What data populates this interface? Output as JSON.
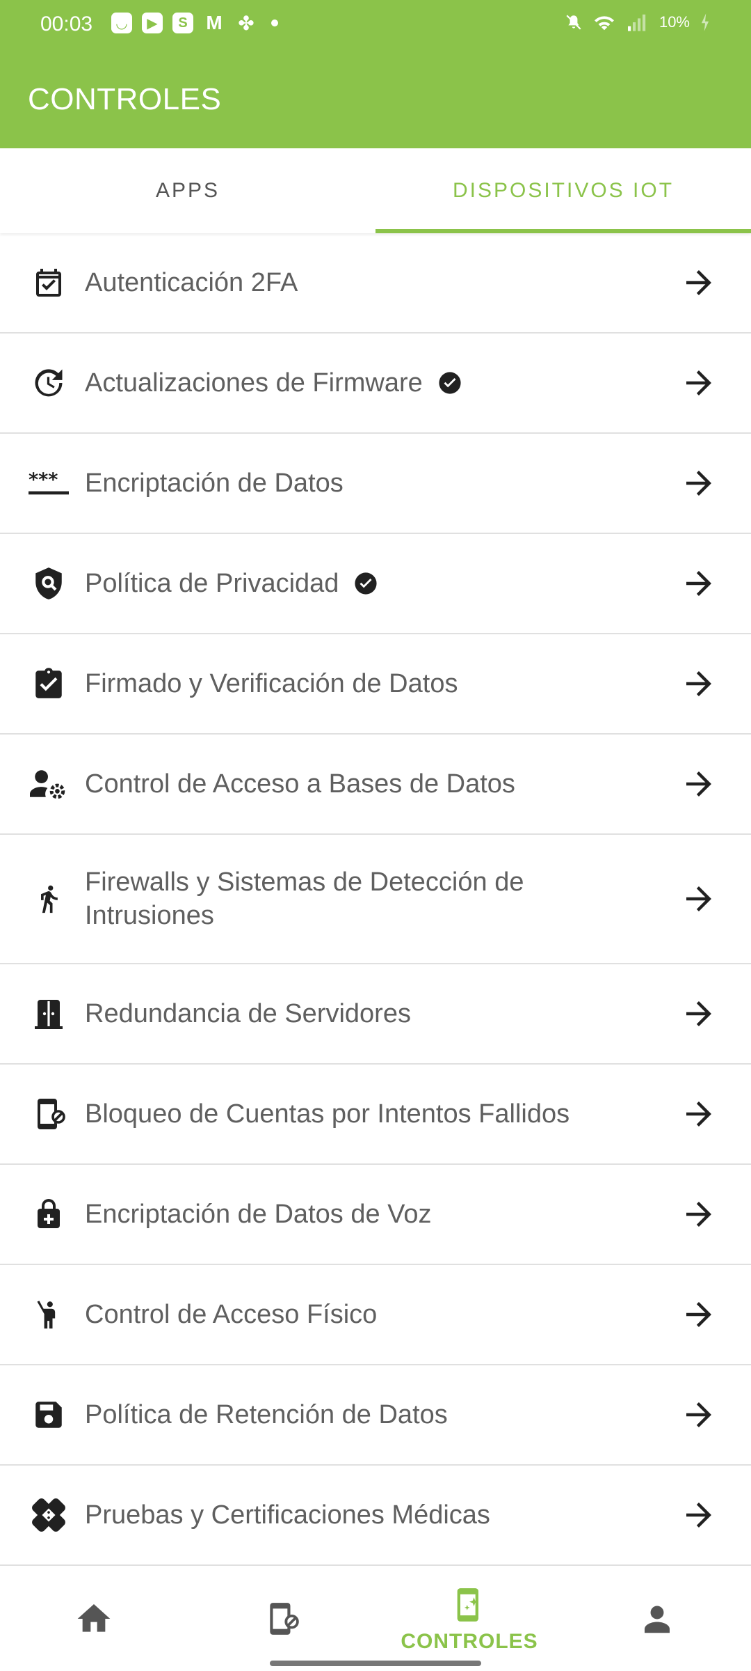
{
  "status_bar": {
    "time": "00:03",
    "battery": "10%",
    "notification_icons": [
      "smile-icon",
      "youtube-icon",
      "s-app-icon",
      "gmail-icon",
      "fan-icon"
    ],
    "system_icons": [
      "mute-icon",
      "wifi-icon",
      "signal-icon",
      "battery-icon"
    ]
  },
  "app_bar": {
    "title": "CONTROLES",
    "color": "#8bc34a"
  },
  "tabs": [
    {
      "label": "APPS",
      "selected": false
    },
    {
      "label": "DISPOSITIVOS IOT",
      "selected": true
    }
  ],
  "controls": [
    {
      "label": "Autenticación 2FA",
      "icon": "calendar-check-icon",
      "verified": false
    },
    {
      "label": "Actualizaciones de Firmware",
      "icon": "update-clock-icon",
      "verified": true
    },
    {
      "label": "Encriptación de Datos",
      "icon": "password-icon",
      "verified": false
    },
    {
      "label": "Política de Privacidad",
      "icon": "shield-search-icon",
      "verified": true
    },
    {
      "label": "Firmado y Verificación de Datos",
      "icon": "clipboard-check-icon",
      "verified": false
    },
    {
      "label": "Control de Acceso a Bases de Datos",
      "icon": "person-gear-icon",
      "verified": false
    },
    {
      "label": "Firewalls y Sistemas de Detección de Intrusiones",
      "icon": "walking-person-icon",
      "verified": false
    },
    {
      "label": "Redundancia de Servidores",
      "icon": "door-icon",
      "verified": false
    },
    {
      "label": "Bloqueo de Cuentas por Intentos Fallidos",
      "icon": "phone-blocked-icon",
      "verified": false
    },
    {
      "label": "Encriptación de Datos de Voz",
      "icon": "lock-plus-icon",
      "verified": false
    },
    {
      "label": "Control de Acceso Físico",
      "icon": "person-raised-hand-icon",
      "verified": false
    },
    {
      "label": "Política de Retención de Datos",
      "icon": "save-icon",
      "verified": false
    },
    {
      "label": "Pruebas y Certificaciones Médicas",
      "icon": "bandage-icon",
      "verified": false
    }
  ],
  "bottom_nav": [
    {
      "icon": "home-icon",
      "label": "",
      "active": false
    },
    {
      "icon": "phone-blocked-icon",
      "label": "",
      "active": false
    },
    {
      "icon": "phone-sparkle-icon",
      "label": "CONTROLES",
      "active": true
    },
    {
      "icon": "person-icon",
      "label": "",
      "active": false
    }
  ]
}
